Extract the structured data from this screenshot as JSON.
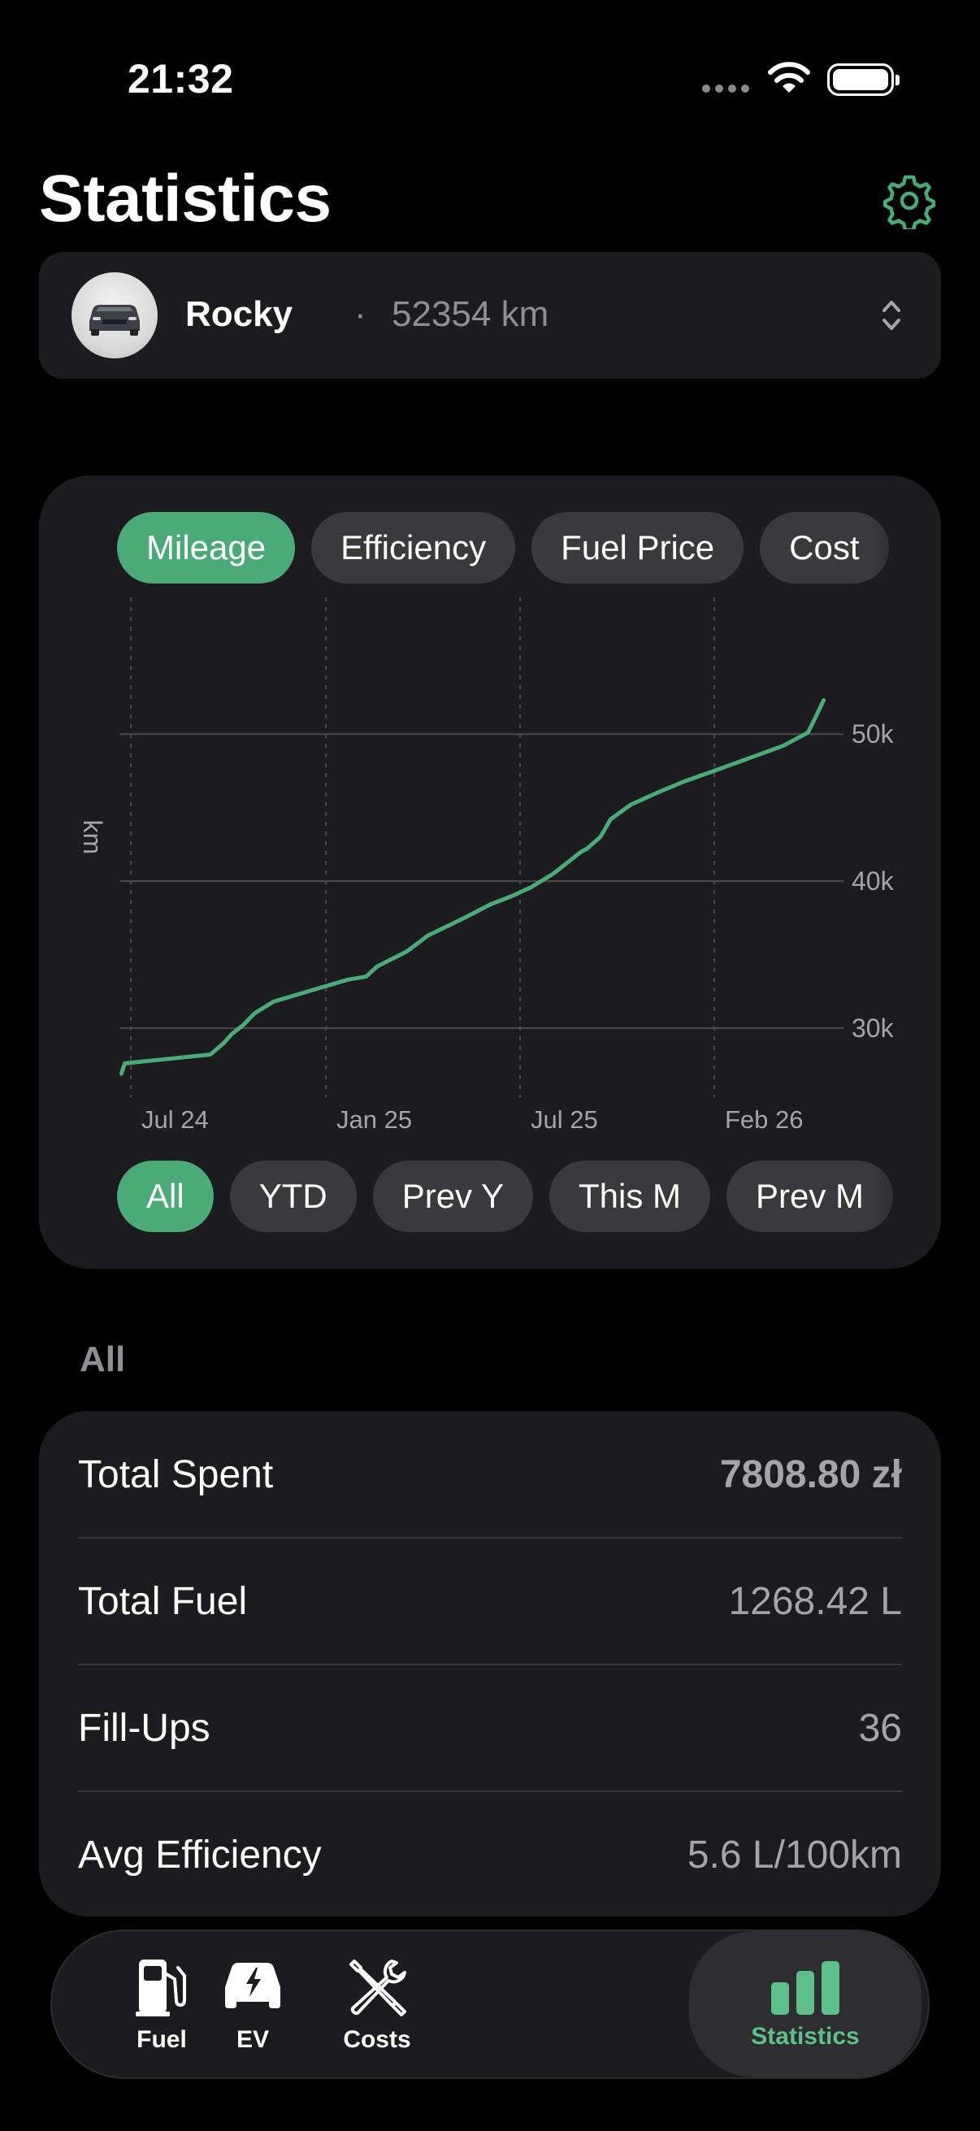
{
  "status_bar": {
    "time": "21:32"
  },
  "header": {
    "title": "Statistics",
    "settings_icon": "gear-icon"
  },
  "vehicle": {
    "name": "Rocky",
    "separator": "·",
    "odometer": "52354 km"
  },
  "metric_tabs": [
    {
      "label": "Mileage",
      "selected": true
    },
    {
      "label": "Efficiency",
      "selected": false
    },
    {
      "label": "Fuel Price",
      "selected": false
    },
    {
      "label": "Cost",
      "selected": false
    }
  ],
  "period_tabs": [
    {
      "label": "All",
      "selected": true
    },
    {
      "label": "YTD",
      "selected": false
    },
    {
      "label": "Prev Y",
      "selected": false
    },
    {
      "label": "This M",
      "selected": false
    },
    {
      "label": "Prev M",
      "selected": false
    }
  ],
  "chart_data": {
    "type": "line",
    "title": "",
    "ylabel": "km",
    "xlabel": "",
    "x_ticks": [
      "Jul 24",
      "Jan 25",
      "Jul 25",
      "Feb 26"
    ],
    "y_ticks": [
      "30k",
      "40k",
      "50k"
    ],
    "y_tick_values": [
      30000,
      40000,
      50000
    ],
    "ylim": [
      25300,
      59300
    ],
    "xlim": [
      "2024-06-01",
      "2026-03-01"
    ],
    "grid": true,
    "color": "#4aab78",
    "series": [
      {
        "name": "",
        "x": [
          "2024-06-02",
          "2024-06-05",
          "2024-08-20",
          "2024-09-01",
          "2024-09-08",
          "2024-09-18",
          "2024-09-28",
          "2024-10-15",
          "2024-12-20",
          "2025-01-05",
          "2025-01-15",
          "2025-02-10",
          "2025-03-01",
          "2025-03-20",
          "2025-04-05",
          "2025-04-25",
          "2025-05-15",
          "2025-06-01",
          "2025-06-20",
          "2025-07-05",
          "2025-07-15",
          "2025-07-20",
          "2025-08-01",
          "2025-08-10",
          "2025-08-28",
          "2025-09-20",
          "2025-10-15",
          "2025-11-10",
          "2025-12-05",
          "2026-01-10",
          "2026-02-01",
          "2026-02-05",
          "2026-02-15"
        ],
        "values": [
          26900,
          27600,
          28200,
          29000,
          29600,
          30200,
          31000,
          31800,
          33300,
          33500,
          34200,
          35200,
          36300,
          37000,
          37600,
          38400,
          39000,
          39600,
          40500,
          41400,
          42000,
          42200,
          43000,
          44200,
          45200,
          46000,
          46800,
          47500,
          48200,
          49200,
          50100,
          50700,
          52300
        ]
      }
    ]
  },
  "stats": {
    "section_label": "All",
    "rows": [
      {
        "label": "Total Spent",
        "value": "7808.80 zł",
        "emphasis": true
      },
      {
        "label": "Total Fuel",
        "value": "1268.42 L",
        "emphasis": false
      },
      {
        "label": "Fill-Ups",
        "value": "36",
        "emphasis": false
      },
      {
        "label": "Avg Efficiency",
        "value": "5.6 L/100km",
        "emphasis": false
      }
    ]
  },
  "tabbar": {
    "items": [
      {
        "label": "Fuel",
        "icon": "fuel-pump-icon",
        "selected": false
      },
      {
        "label": "EV",
        "icon": "ev-car-icon",
        "selected": false
      },
      {
        "label": "Costs",
        "icon": "wrench-screwdriver-icon",
        "selected": false
      },
      {
        "label": "Statistics",
        "icon": "bar-chart-icon",
        "selected": true
      }
    ]
  },
  "colors": {
    "accent": "#4aab78",
    "card": "#1c1c1e",
    "pill": "#3a3a3c",
    "muted": "#8e8e93"
  }
}
